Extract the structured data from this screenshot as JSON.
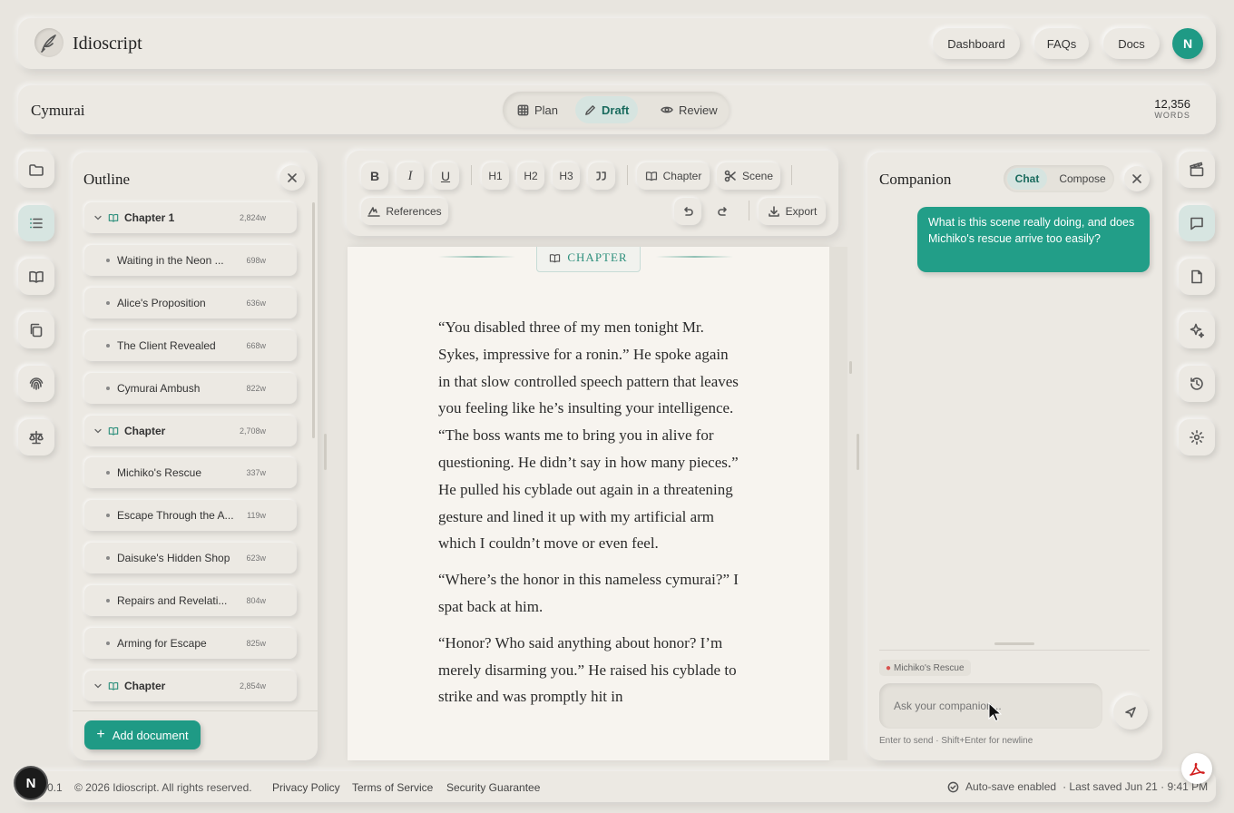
{
  "app": {
    "name": "Idioscript"
  },
  "nav": {
    "dashboard": "Dashboard",
    "faqs": "FAQs",
    "docs": "Docs",
    "avatar": "N"
  },
  "doc": {
    "title": "Cymurai",
    "word_count": "12,356",
    "word_label": "WORDS"
  },
  "modes": [
    {
      "label": "Plan"
    },
    {
      "label": "Draft",
      "active": true
    },
    {
      "label": "Review"
    }
  ],
  "left_rail": [
    "folder-icon",
    "outline-icon",
    "book-icon",
    "copy-icon",
    "fingerprint-icon",
    "scales-icon"
  ],
  "outline": {
    "title": "Outline",
    "items": [
      {
        "type": "chapter",
        "label": "Chapter 1",
        "words": "2,824w"
      },
      {
        "type": "scene",
        "label": "Waiting in the Neon ...",
        "words": "698w"
      },
      {
        "type": "scene",
        "label": "Alice's Proposition",
        "words": "636w"
      },
      {
        "type": "scene",
        "label": "The Client Revealed",
        "words": "668w"
      },
      {
        "type": "scene",
        "label": "Cymurai Ambush",
        "words": "822w"
      },
      {
        "type": "chapter",
        "label": "Chapter",
        "words": "2,708w"
      },
      {
        "type": "scene",
        "label": "Michiko's Rescue",
        "words": "337w"
      },
      {
        "type": "scene",
        "label": "Escape Through the A...",
        "words": "119w"
      },
      {
        "type": "scene",
        "label": "Daisuke's Hidden Shop",
        "words": "623w"
      },
      {
        "type": "scene",
        "label": "Repairs and Revelati...",
        "words": "804w"
      },
      {
        "type": "scene",
        "label": "Arming for Escape",
        "words": "825w"
      },
      {
        "type": "chapter",
        "label": "Chapter",
        "words": "2,854w"
      }
    ],
    "add_button": "Add document"
  },
  "toolbar": {
    "bold": "B",
    "italic": "I",
    "underline": "U",
    "h1": "H1",
    "h2": "H2",
    "h3": "H3",
    "chapter": "Chapter",
    "scene": "Scene",
    "references": "References",
    "export": "Export"
  },
  "editor": {
    "badge": "CHAPTER",
    "paragraphs": [
      "“You disabled three of my men tonight Mr. Sykes, impressive for a ronin.” He spoke again in that slow controlled speech pattern that leaves you feeling like he’s insulting your intelligence. “The boss wants me to bring you in alive for questioning. He didn’t say in how many pieces.” He pulled his cyblade out again in a threatening gesture and lined it up with my artificial arm which I couldn’t move or even feel.",
      "“Where’s the honor in this nameless cymurai?” I spat back at him.",
      "“Honor? Who said anything about honor? I’m merely disarming you.” He raised his cyblade to strike and was promptly hit in"
    ]
  },
  "companion": {
    "title": "Companion",
    "tabs": [
      "Chat",
      "Compose"
    ],
    "message": "What is this scene really doing, and does Michiko's rescue arrive too easily?",
    "context": "Michiko's Rescue",
    "placeholder": "Ask your companion...",
    "hint": "Enter to send · Shift+Enter for newline"
  },
  "right_rail": [
    "clapperboard-icon",
    "chat-icon",
    "document-icon",
    "sparkle-icon",
    "history-icon",
    "gear-icon"
  ],
  "footer": {
    "version": "v0.1",
    "copyright": "© 2026 Idioscript. All rights reserved.",
    "privacy": "Privacy Policy",
    "terms": "Terms of Service",
    "security": "Security Guarantee",
    "autosave": "Auto-save enabled",
    "last_saved": "· Last saved Jun 21 · 9:41 PM",
    "n_logo": "N"
  },
  "colors": {
    "accent": "#1f9a85",
    "background": "#e8e5df",
    "paper": "#f7f4ef"
  }
}
